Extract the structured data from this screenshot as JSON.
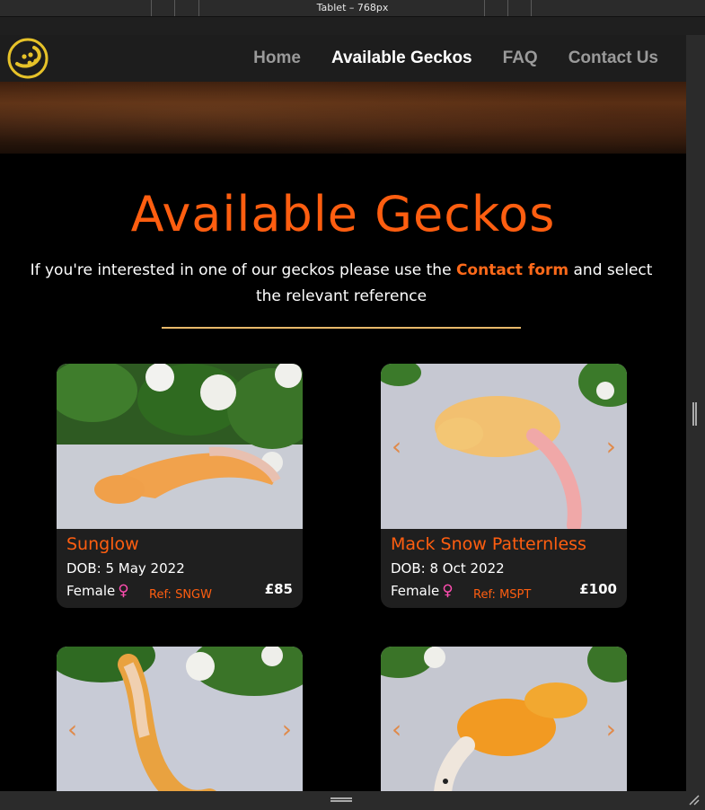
{
  "devtools": {
    "viewport_label": "Tablet – 768px"
  },
  "nav": {
    "links": [
      {
        "label": "Home",
        "active": false
      },
      {
        "label": "Available Geckos",
        "active": true
      },
      {
        "label": "FAQ",
        "active": false
      },
      {
        "label": "Contact Us",
        "active": false
      }
    ]
  },
  "page": {
    "title": "Available Geckos",
    "intro_before": "If you're interested in one of our geckos please use the ",
    "intro_link": "Contact form",
    "intro_after": " and select the relevant reference"
  },
  "geckos": [
    {
      "name": "Sunglow",
      "dob": "DOB: 5 May 2022",
      "sex": "Female",
      "ref": "Ref: SNGW",
      "price": "£85"
    },
    {
      "name": "Mack Snow Patternless",
      "dob": "DOB: 8 Oct 2022",
      "sex": "Female",
      "ref": "Ref: MSPT",
      "price": "£100"
    },
    {
      "name": "",
      "dob": "",
      "sex": "",
      "ref": "",
      "price": ""
    },
    {
      "name": "",
      "dob": "",
      "sex": "",
      "ref": "",
      "price": ""
    }
  ],
  "icons": {
    "female": "female-symbol-icon",
    "prev": "chevron-left-icon",
    "next": "chevron-right-icon",
    "logo": "gecko-logo-icon"
  },
  "colors": {
    "accent": "#ff5e10",
    "divider": "#e8b86a",
    "female": "#ff4db0"
  }
}
